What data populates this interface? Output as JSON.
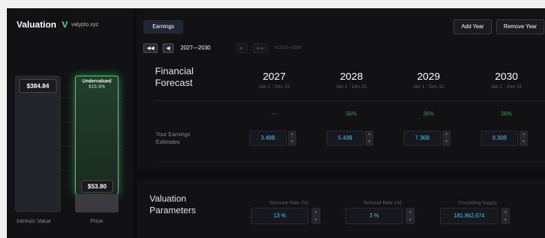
{
  "brand": {
    "title": "Valuation",
    "icon": "V",
    "site": "valypto.xyz"
  },
  "chart": {
    "intrinsic_value": "$384.84",
    "price": "$53.80",
    "status": "Undervalued",
    "status_pct": "615.3%",
    "intrinsic_label": "Intrinsic Value",
    "price_label": "Price",
    "accent": "#3ee07a"
  },
  "forecast": {
    "tab": "Earnings",
    "add_year": "Add Year",
    "remove_year": "Remove Year",
    "range": "2027—2030",
    "range_of": "of 2025—2030",
    "title_line1": "Financial",
    "title_line2": "Forecast",
    "row_label_line1": "Your Earnings",
    "row_label_line2": "Estimates",
    "years": [
      {
        "year": "2027",
        "range": "Jan 1 - Dec 31",
        "growth": "—",
        "estimate": "3.49B"
      },
      {
        "year": "2028",
        "range": "Jan 1 - Dec 31",
        "growth": "56%",
        "estimate": "5.43B"
      },
      {
        "year": "2029",
        "range": "Jan 1 - Dec 31",
        "growth": "36%",
        "estimate": "7.36B"
      },
      {
        "year": "2030",
        "range": "Jan 1 - Dec 31",
        "growth": "26%",
        "estimate": "9.30B"
      }
    ]
  },
  "params": {
    "title_line1": "Valuation",
    "title_line2": "Parameters",
    "discount_label": "Discount Rate (%)",
    "discount_value": "13 %",
    "terminal_label": "Terminal Rate (%)",
    "terminal_value": "3 %",
    "supply_label": "Circulating Supply",
    "supply_value": "181,862,674"
  },
  "icons": {
    "first": "◀◀",
    "prev": "◀",
    "next": "▶",
    "last": "▶▶",
    "up": "▲",
    "down": "▼"
  }
}
